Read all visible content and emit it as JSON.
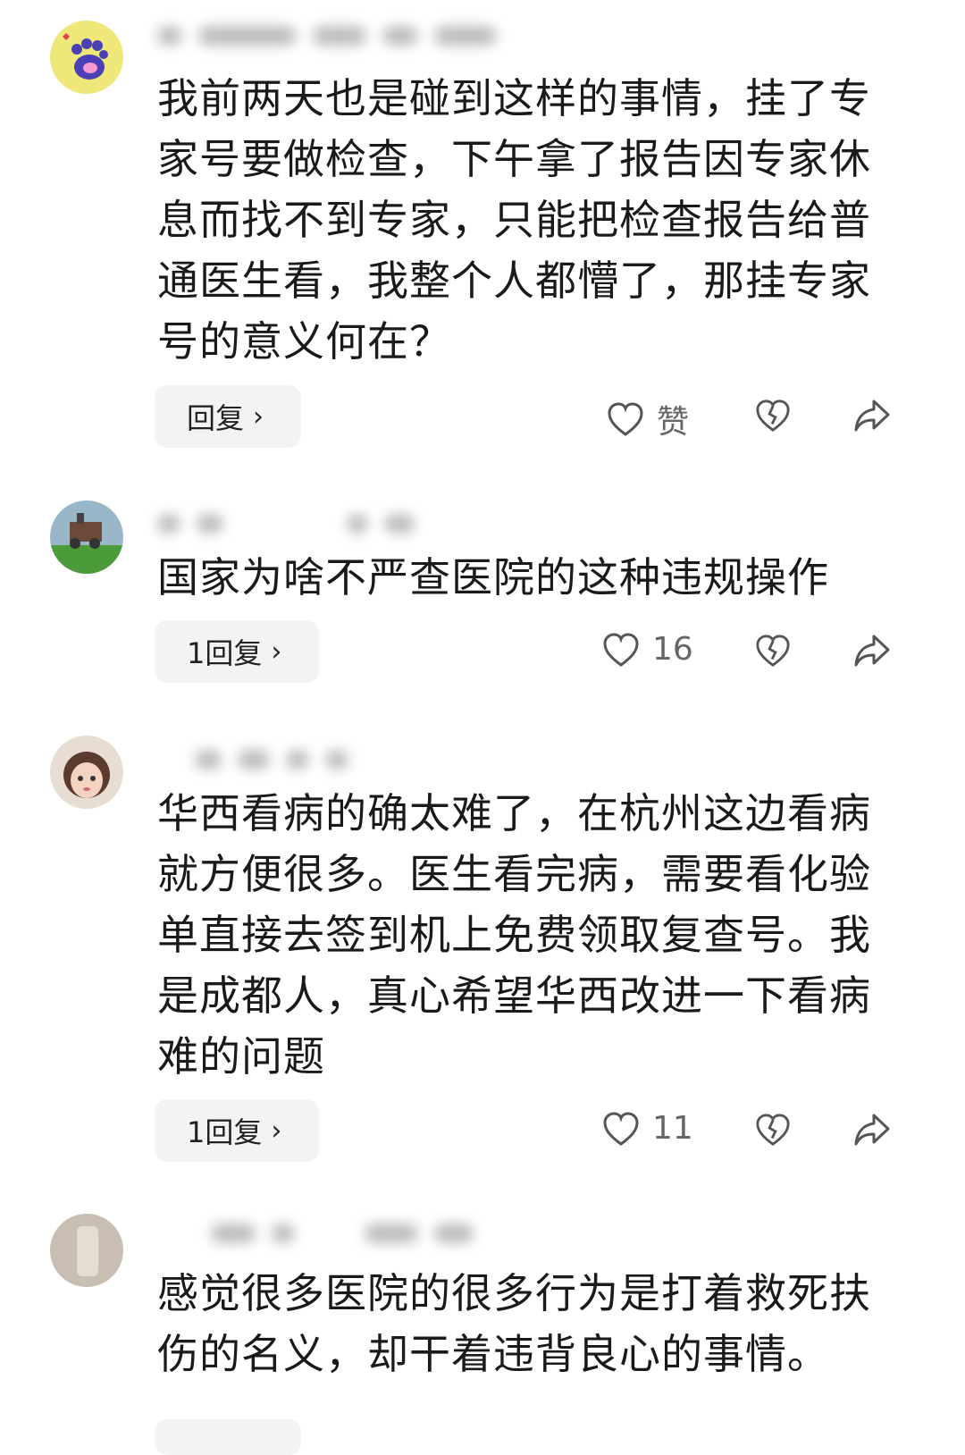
{
  "comments": [
    {
      "text": "我前两天也是碰到这样的事情，挂了专家号要做检查，下午拿了报告因专家休息而找不到专家，只能把检查报告给普通医生看，我整个人都懵了，那挂专家号的意义何在？",
      "reply_label": "回复",
      "like_label": "赞"
    },
    {
      "text": "国家为啥不严查医院的这种违规操作",
      "reply_label": "1回复",
      "like_label": "16"
    },
    {
      "text": "华西看病的确太难了，在杭州这边看病就方便很多。医生看完病，需要看化验单直接去签到机上免费领取复查号。我是成都人，真心希望华西改进一下看病难的问题",
      "reply_label": "1回复",
      "like_label": "11"
    },
    {
      "text": "感觉很多医院的很多行为是打着救死扶伤的名义，却干着违背良心的事情。"
    }
  ],
  "icons": {
    "chevron": "chevron-right-icon",
    "like": "heart-outline-icon",
    "dislike": "broken-heart-icon",
    "share": "share-arrow-icon"
  },
  "colors": {
    "text": "#1a1a1a",
    "button_bg": "#f3f3f3",
    "count": "#666666"
  }
}
